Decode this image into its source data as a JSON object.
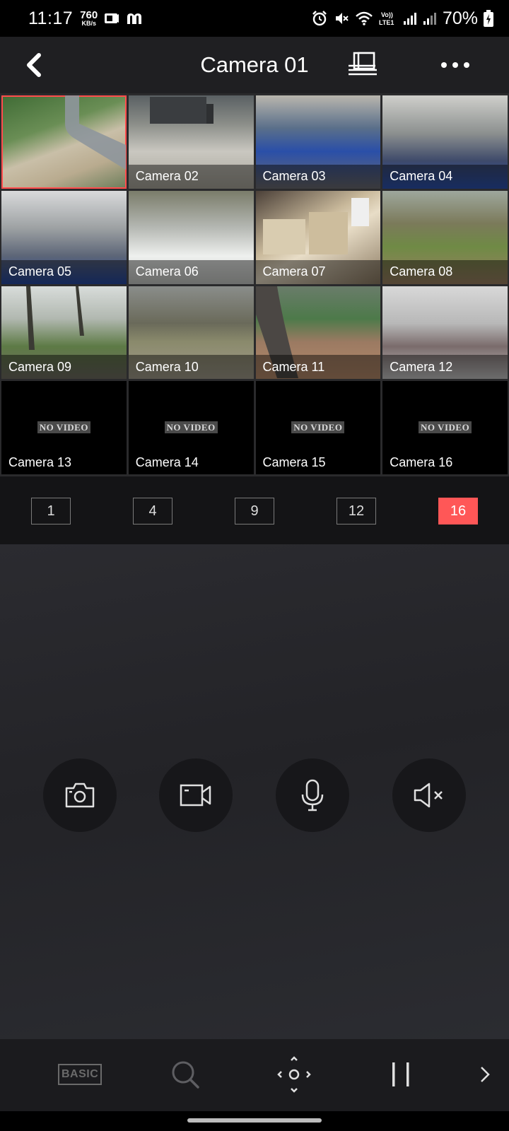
{
  "status_bar": {
    "time": "11:17",
    "speed_value": "760",
    "speed_unit": "KB/s",
    "battery": "70%",
    "icons": [
      "messenger-icon",
      "m-app-icon",
      "alarm-icon",
      "mute-icon",
      "wifi-icon",
      "volte-icon",
      "signal-icon",
      "signal-icon",
      "battery-charging-icon"
    ]
  },
  "header": {
    "title": "Camera 01",
    "icons": [
      "back-icon",
      "layout-monitor-icon",
      "more-icon"
    ]
  },
  "cameras": [
    {
      "label": "",
      "state": "video",
      "selected": true
    },
    {
      "label": "Camera 02",
      "state": "video"
    },
    {
      "label": "Camera 03",
      "state": "video"
    },
    {
      "label": "Camera 04",
      "state": "video"
    },
    {
      "label": "Camera 05",
      "state": "video"
    },
    {
      "label": "Camera 06",
      "state": "video"
    },
    {
      "label": "Camera 07",
      "state": "video"
    },
    {
      "label": "Camera 08",
      "state": "video"
    },
    {
      "label": "Camera 09",
      "state": "video"
    },
    {
      "label": "Camera 10",
      "state": "video"
    },
    {
      "label": "Camera 11",
      "state": "video"
    },
    {
      "label": "Camera 12",
      "state": "video"
    },
    {
      "label": "Camera 13",
      "state": "no-video"
    },
    {
      "label": "Camera 14",
      "state": "no-video"
    },
    {
      "label": "Camera 15",
      "state": "no-video"
    },
    {
      "label": "Camera 16",
      "state": "no-video"
    }
  ],
  "no_video_text": "NO VIDEO",
  "layouts": {
    "options": [
      "1",
      "4",
      "9",
      "12",
      "16"
    ],
    "selected": "16"
  },
  "controls": [
    "camera-snapshot-icon",
    "video-record-icon",
    "microphone-icon",
    "speaker-muted-icon"
  ],
  "toolbar": {
    "basic_label": "BASIC",
    "icons": [
      "search-icon",
      "ptz-icon",
      "pause-icon",
      "chevron-right-icon"
    ]
  },
  "colors": {
    "accent": "#ff5757",
    "header_bg": "#1f1f22",
    "panel_bg": "#141416",
    "button_bg": "#17171a"
  }
}
